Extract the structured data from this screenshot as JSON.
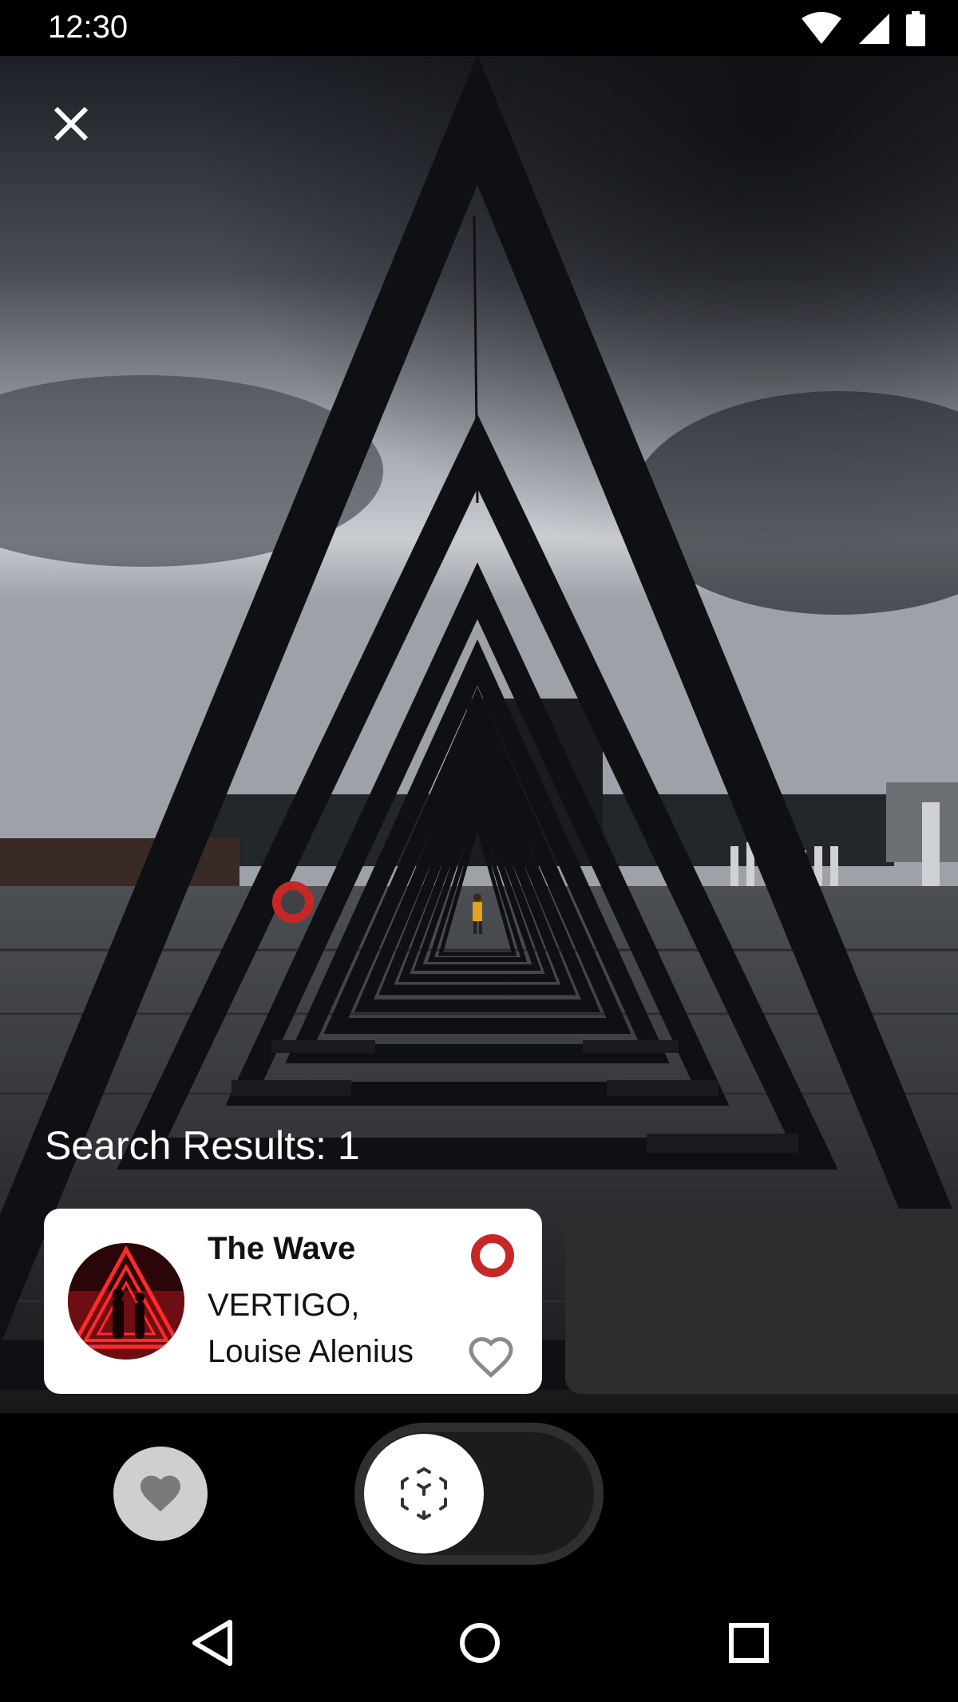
{
  "status_bar": {
    "time": "12:30",
    "icons": [
      "wifi-icon",
      "cellular-icon",
      "battery-icon"
    ]
  },
  "viewer": {
    "close_icon": "close-icon",
    "hotspot_color": "#c62828",
    "results_label": "Search Results: 1"
  },
  "results": [
    {
      "title": "The Wave",
      "subtitle_line1": "VERTIGO,",
      "subtitle_line2": "Louise Alenius",
      "marker_icon": "location-marker-icon",
      "favorite_icon": "heart-outline-icon"
    }
  ],
  "controls": {
    "favorites_icon": "heart-icon",
    "mode_toggle_icon": "ar-cube-icon"
  },
  "nav": {
    "back_icon": "back-icon",
    "home_icon": "home-icon",
    "recents_icon": "recents-icon"
  },
  "colors": {
    "accent": "#c62828",
    "card_bg": "#ffffff",
    "peek_card_bg": "#2d2d2d"
  }
}
